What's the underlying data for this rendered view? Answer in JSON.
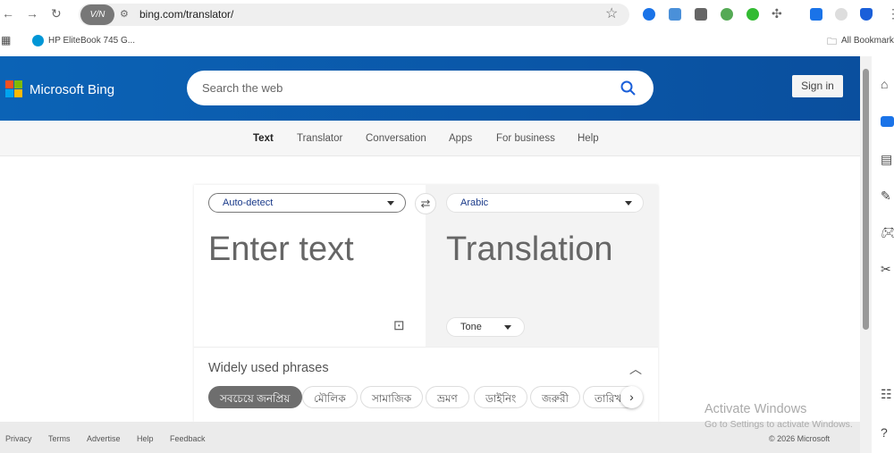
{
  "browser": {
    "url": "bing.com/translator/",
    "vpn_label": "V/N",
    "bookmark": "HP EliteBook 745 G...",
    "all_bookmarks": "All Bookmarks"
  },
  "header": {
    "brand": "Microsoft Bing",
    "search_placeholder": "Search the web",
    "sign_in": "Sign in",
    "brand_color": "#0b63b6"
  },
  "nav": [
    "Text",
    "Translator",
    "Conversation",
    "Apps",
    "For business",
    "Help"
  ],
  "translator": {
    "source_lang": "Auto-detect",
    "target_lang": "Arabic",
    "input_placeholder": "Enter text",
    "output_placeholder": "Translation",
    "tone": "Tone",
    "phrases_title": "Widely used phrases",
    "chips": [
      "সবচেয়ে জনপ্রিয়",
      "মৌলিক",
      "সামাজিক",
      "ভ্রমণ",
      "ডাইনিং",
      "জরুরী",
      "তারিখ"
    ]
  },
  "footer": {
    "links": [
      "Privacy",
      "Terms",
      "Advertise",
      "Help",
      "Feedback"
    ],
    "copyright": "© 2026 Microsoft"
  },
  "watermark": {
    "title": "Activate Windows",
    "subtitle": "Go to Settings to activate Windows."
  }
}
